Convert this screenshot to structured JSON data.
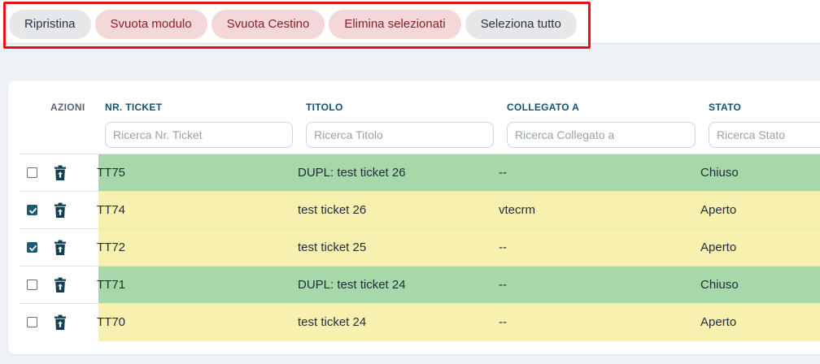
{
  "toolbar": {
    "buttons": [
      {
        "label": "Ripristina",
        "variant": "neutral"
      },
      {
        "label": "Svuota modulo",
        "variant": "danger"
      },
      {
        "label": "Svuota Cestino",
        "variant": "danger"
      },
      {
        "label": "Elimina selezionati",
        "variant": "danger"
      },
      {
        "label": "Seleziona tutto",
        "variant": "neutral"
      }
    ]
  },
  "table": {
    "actions_header": "AZIONI",
    "columns": [
      {
        "header": "NR. TICKET",
        "placeholder": "Ricerca Nr. Ticket"
      },
      {
        "header": "TITOLO",
        "placeholder": "Ricerca Titolo"
      },
      {
        "header": "COLLEGATO A",
        "placeholder": "Ricerca Collegato a"
      },
      {
        "header": "STATO",
        "placeholder": "Ricerca Stato"
      }
    ],
    "rows": [
      {
        "checked": false,
        "ticket": "TT75",
        "title": "DUPL: test ticket 26",
        "linked": "--",
        "status": "Chiuso"
      },
      {
        "checked": true,
        "ticket": "TT74",
        "title": "test ticket 26",
        "linked": "vtecrm",
        "status": "Aperto"
      },
      {
        "checked": true,
        "ticket": "TT72",
        "title": "test ticket 25",
        "linked": "--",
        "status": "Aperto"
      },
      {
        "checked": false,
        "ticket": "TT71",
        "title": "DUPL: test ticket 24",
        "linked": "--",
        "status": "Chiuso"
      },
      {
        "checked": false,
        "ticket": "TT70",
        "title": "test ticket 24",
        "linked": "--",
        "status": "Aperto"
      }
    ],
    "icons": {
      "row_action": "trash-restore-icon",
      "checkbox_checked": "checkmark-icon"
    }
  },
  "colors": {
    "closed_row": "#a6d8a9",
    "open_row": "#f8f0ae",
    "danger_button_bg": "#f4d7d9",
    "neutral_button_bg": "#e6e7e9",
    "highlight_border": "#e4121a",
    "header_text": "#13536b"
  }
}
